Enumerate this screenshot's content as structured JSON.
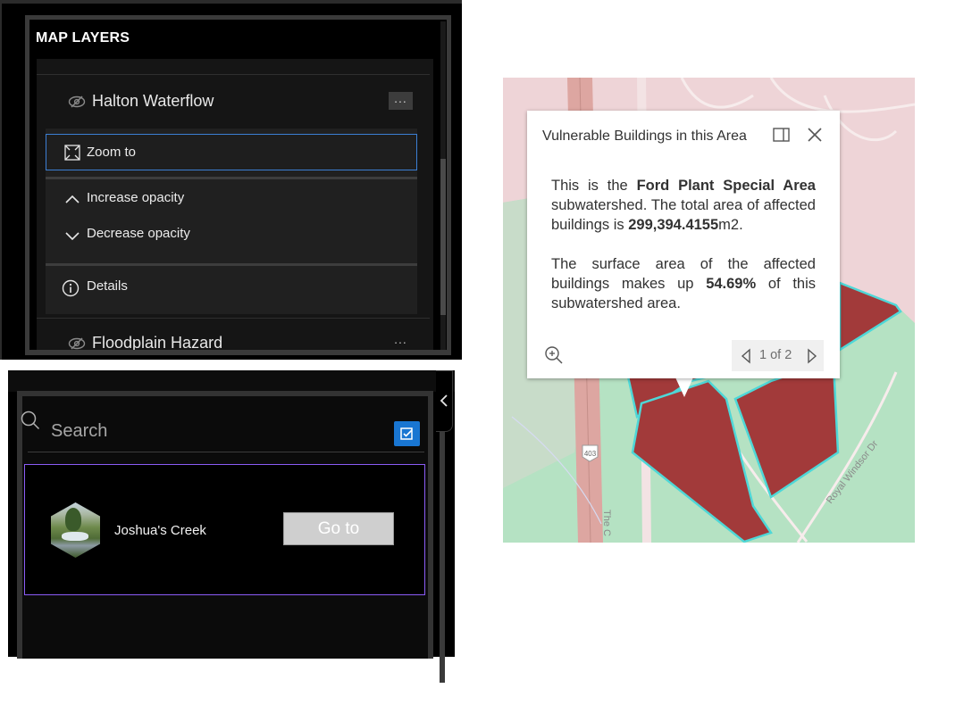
{
  "layers_panel": {
    "title": "MAP LAYERS",
    "layers": [
      {
        "name": "Halton Waterflow",
        "icon": "eye-hidden-icon"
      },
      {
        "name": "Floodplain Hazard",
        "icon": "eye-hidden-icon"
      }
    ],
    "more_label": "...",
    "menu": {
      "zoom_to": "Zoom to",
      "increase_opacity": "Increase opacity",
      "decrease_opacity": "Decrease opacity",
      "details": "Details"
    },
    "colors": {
      "background": "#000000",
      "focus_border": "#3c7fd4"
    }
  },
  "search_panel": {
    "placeholder": "Search",
    "results": [
      {
        "name": "Joshua's Creek",
        "button_label": "Go to"
      }
    ],
    "colors": {
      "filter_button": "#1976d2",
      "card_border": "#8b5cf6"
    }
  },
  "popup": {
    "title": "Vulnerable Buildings in this Area",
    "paragraph1": {
      "t1": "This is the ",
      "subwatershed": "Ford Plant Special Area",
      "t2": " subwatershed. The total area of affected buildings is ",
      "area": "299,394.4155",
      "unit": "m2."
    },
    "paragraph2": {
      "t1": "The surface area of the affected buildings makes up ",
      "percent": "54.69%",
      "t2": " of this subwatershed area."
    },
    "pager": "1 of 2"
  },
  "map": {
    "road_shield": "403",
    "street_label": "Royal Windsor Dr",
    "street_label_partial": "The C",
    "colors": {
      "base": "#eed4d7",
      "green_area": "#b5e2c3",
      "buildings": "#a23a3a",
      "highway": "#dda6a1",
      "outline": "#4ed7d7"
    }
  }
}
